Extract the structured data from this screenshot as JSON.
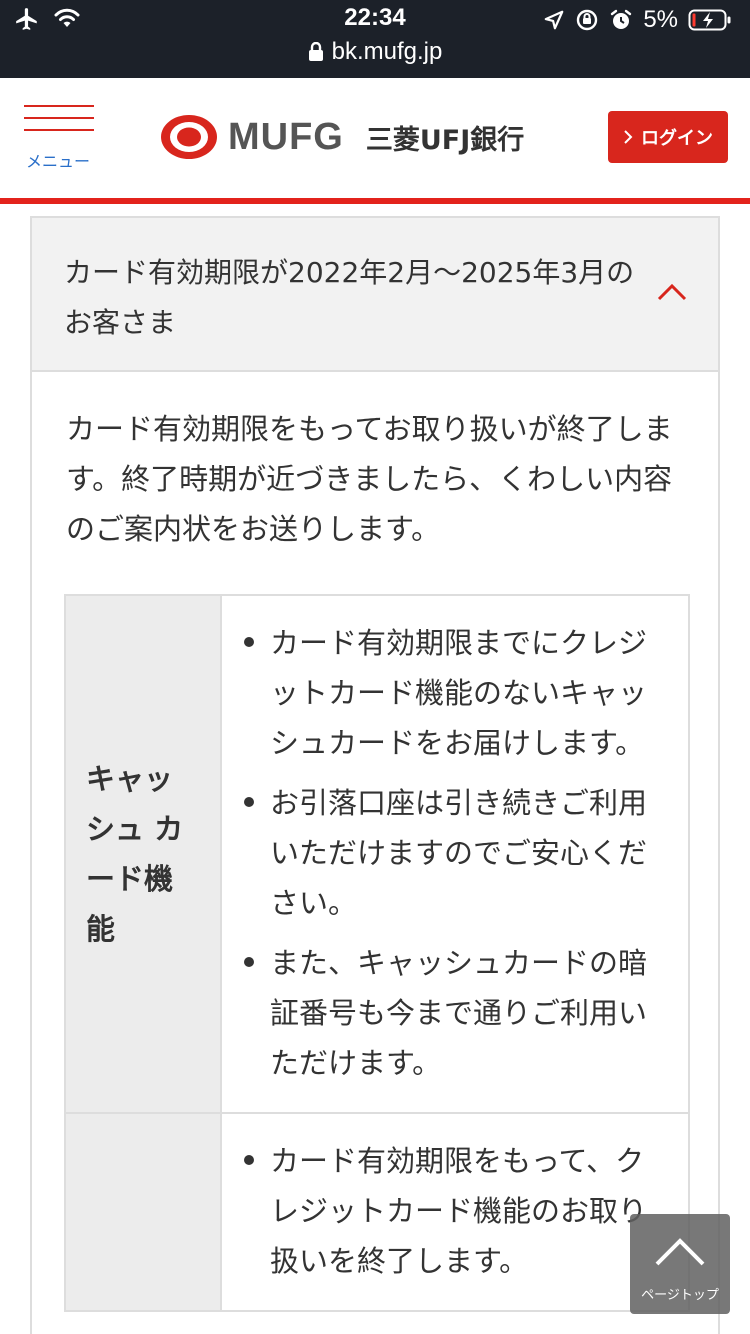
{
  "status_bar": {
    "time": "22:34",
    "url": "bk.mufg.jp",
    "battery_percent": "5%",
    "icons": [
      "airplane-icon",
      "wifi-icon",
      "lock-icon",
      "location-arrow-icon",
      "orientation-lock-icon",
      "alarm-icon",
      "battery-charging-icon"
    ]
  },
  "header": {
    "menu_label": "メニュー",
    "logo_text": "MUFG",
    "bank_name": "三菱UFJ銀行",
    "login_label": "ログイン",
    "accent_color": "#d8261d"
  },
  "accordion": {
    "title": "カード有効期限が2022年2月〜2025年3月のお客さま",
    "expanded": true,
    "description": "カード有効期限をもってお取り扱いが終了します。終了時期が近づきましたら、くわしい内容のご案内状をお送りします。"
  },
  "table": {
    "rows": [
      {
        "header": "キャッシュ カード機能",
        "items": [
          "カード有効期限までにクレジットカード機能のないキャッシュカードをお届けします。",
          "お引落口座は引き続きご利用いただけますのでご安心ください。",
          "また、キャッシュカードの暗証番号も今まで通りご利用いただけます。"
        ]
      },
      {
        "header": "",
        "items": [
          "カード有効期限をもって、クレジットカード機能のお取り扱いを終了します。"
        ]
      }
    ]
  },
  "page_top": {
    "label": "ページトップ"
  }
}
